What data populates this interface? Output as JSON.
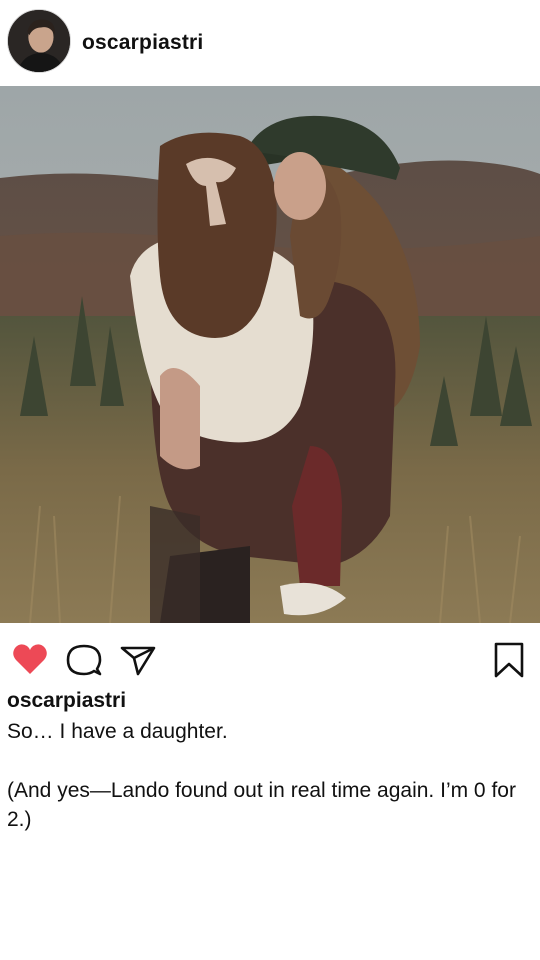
{
  "post": {
    "username": "oscarpiastri",
    "caption_username": "oscarpiastri",
    "caption": "So… I have a daughter.\n\n(And yes—Lando found out in real time again. I’m 0 for 2.)",
    "liked": true
  },
  "icons": {
    "like": "heart-icon",
    "comment": "speech-bubble-icon",
    "share": "paper-plane-icon",
    "save": "bookmark-icon"
  },
  "colors": {
    "like_active": "#ed4956",
    "icon_stroke": "#111111"
  }
}
